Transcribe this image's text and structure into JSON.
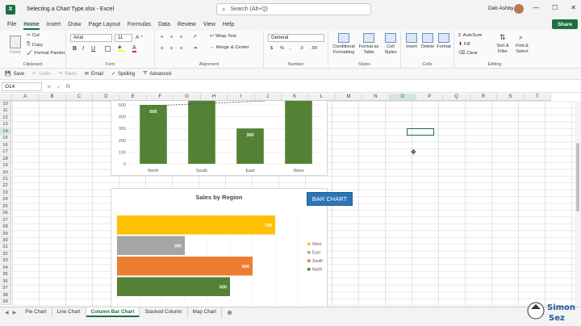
{
  "titlebar": {
    "filename": "Selecting a Chart Type.xlsx  -  Excel",
    "search_placeholder": "Search (Alt+Q)",
    "user": "Deb Ashby"
  },
  "menu": {
    "tabs": [
      "File",
      "Home",
      "Insert",
      "Draw",
      "Page Layout",
      "Formulas",
      "Data",
      "Review",
      "View",
      "Help"
    ],
    "active": "Home",
    "share": "Share"
  },
  "ribbon": {
    "paste": "Paste",
    "cut": "Cut",
    "copy": "Copy",
    "format_painter": "Format Painter",
    "clipboard": "Clipboard",
    "font_name": "Arial",
    "font_size": "11",
    "font_group": "Font",
    "wrap_text": "Wrap Text",
    "merge_center": "Merge & Center",
    "alignment": "Alignment",
    "number_format": "General",
    "number": "Number",
    "conditional_formatting": "Conditional Formatting",
    "format_as_table": "Format as Table",
    "cell_styles": "Cell Styles",
    "styles": "Styles",
    "insert": "Insert",
    "delete": "Delete",
    "format": "Format",
    "cells": "Cells",
    "autosum": "AutoSum",
    "fill": "Fill",
    "clear": "Clear",
    "sort_filter": "Sort & Filter",
    "find_select": "Find & Select",
    "editing": "Editing"
  },
  "qat": {
    "save": "Save",
    "undo": "Undo",
    "redo": "Redo",
    "email": "Email",
    "spelling": "Spelling",
    "advanced": "Advanced"
  },
  "formula_bar": {
    "name_box": "O14",
    "fx": "fx"
  },
  "columns": [
    "A",
    "B",
    "C",
    "D",
    "E",
    "F",
    "G",
    "H",
    "I",
    "J",
    "K",
    "L",
    "M",
    "N",
    "O",
    "P",
    "Q",
    "R",
    "S",
    "T"
  ],
  "rows": [
    "10",
    "11",
    "12",
    "13",
    "14",
    "15",
    "16",
    "17",
    "18",
    "19",
    "20",
    "21",
    "22",
    "23",
    "24",
    "25",
    "26",
    "27",
    "28",
    "29",
    "30",
    "31",
    "32",
    "33",
    "34",
    "35",
    "36",
    "37",
    "38",
    "39"
  ],
  "annotation_label": "BAR CHART",
  "chart_data": [
    {
      "type": "bar",
      "orientation": "vertical",
      "categories": [
        "North",
        "South",
        "East",
        "West"
      ],
      "values": [
        500,
        700,
        300,
        600
      ],
      "data_labels": [
        "500",
        "",
        "300",
        ""
      ],
      "y_ticks": [
        "500",
        "400",
        "300",
        "200",
        "100",
        "0"
      ],
      "ylim": [
        0,
        500
      ],
      "clipped_top": true,
      "trendline": "dashed",
      "color": "#548235"
    },
    {
      "type": "bar",
      "orientation": "horizontal",
      "title": "Sales by Region",
      "categories": [
        "West",
        "East",
        "South",
        "North"
      ],
      "values": [
        700,
        300,
        600,
        500
      ],
      "data_labels": [
        "700",
        "300",
        "600",
        "500"
      ],
      "colors": [
        "#ffc000",
        "#a5a5a5",
        "#ed7d31",
        "#548235"
      ],
      "legend": [
        "West",
        "East",
        "South",
        "North"
      ],
      "legend_position": "right",
      "xlim": [
        0,
        800
      ]
    }
  ],
  "sheets": [
    "Pie Chart",
    "Line Chart",
    "Column Bar Chart",
    "Stacked Column",
    "Map Chart"
  ],
  "active_sheet": "Column Bar Chart",
  "colors": {
    "excel_green": "#1d6f42",
    "annotation_blue": "#2e75b6"
  }
}
